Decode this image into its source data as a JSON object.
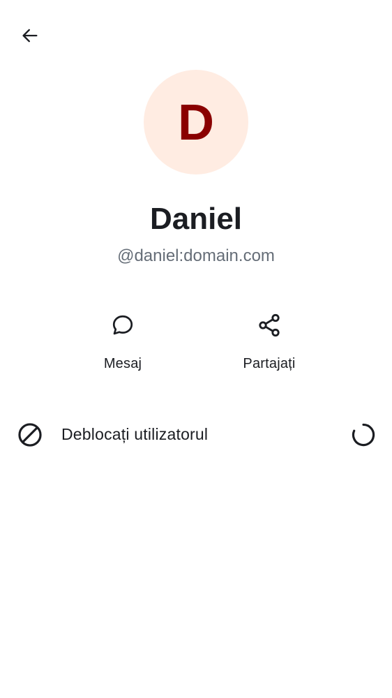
{
  "header": {
    "back_icon": "arrow-left-icon"
  },
  "profile": {
    "avatar_initial": "D",
    "avatar_bg_color": "#ffece2",
    "avatar_letter_color": "#8a0000",
    "display_name": "Daniel",
    "user_id": "@daniel:domain.com"
  },
  "actions": [
    {
      "label": "Mesaj",
      "icon": "chat-bubble-icon"
    },
    {
      "label": "Partajați",
      "icon": "share-icon"
    }
  ],
  "unblock": {
    "label": "Deblocați utilizatorul",
    "icon": "block-icon",
    "status_icon": "loading-spinner-icon"
  }
}
